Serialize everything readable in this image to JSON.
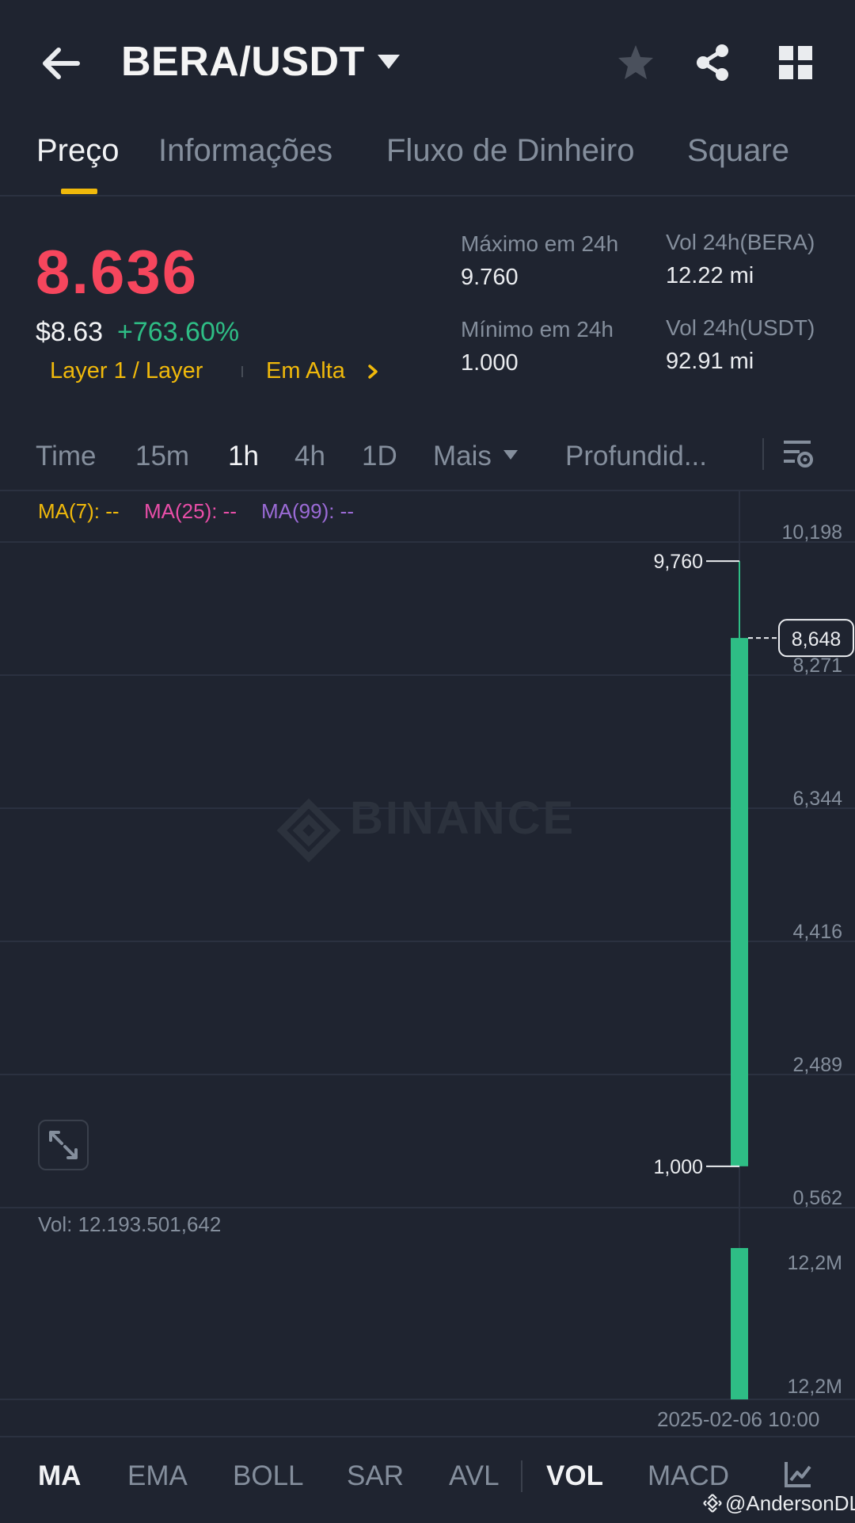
{
  "header": {
    "pair": "BERA/USDT"
  },
  "tabs": [
    {
      "label": "Preço",
      "active": true
    },
    {
      "label": "Informações",
      "active": false
    },
    {
      "label": "Fluxo de Dinheiro",
      "active": false
    },
    {
      "label": "Square",
      "active": false
    }
  ],
  "ticker": {
    "last_price": "8.636",
    "usd_price": "$8.63",
    "change_pct": "+763.60%",
    "tags": [
      "Layer 1 / Layer",
      "Em Alta"
    ],
    "high_label": "Máximo em 24h",
    "high_value": "9.760",
    "low_label": "Mínimo em 24h",
    "low_value": "1.000",
    "vol_base_label": "Vol 24h(BERA)",
    "vol_base_value": "12.22 mi",
    "vol_quote_label": "Vol 24h(USDT)",
    "vol_quote_value": "92.91 mi"
  },
  "timeframes": [
    {
      "label": "Time",
      "active": false
    },
    {
      "label": "15m",
      "active": false
    },
    {
      "label": "1h",
      "active": true
    },
    {
      "label": "4h",
      "active": false
    },
    {
      "label": "1D",
      "active": false
    },
    {
      "label": "Mais",
      "active": false
    },
    {
      "label": "Profundid...",
      "active": false
    }
  ],
  "ma": [
    {
      "label": "MA(7): --",
      "color": "#f0b90b"
    },
    {
      "label": "MA(25): --",
      "color": "#e94ea8"
    },
    {
      "label": "MA(99): --",
      "color": "#9b6bd6"
    }
  ],
  "chart_data": {
    "type": "candlestick",
    "watermark": "BINANCE",
    "y_ticks": [
      "10,198",
      "8,271",
      "6,344",
      "4,416",
      "2,489",
      "0,562"
    ],
    "y_tick_values": [
      10.198,
      8.271,
      6.344,
      4.416,
      2.489,
      0.562
    ],
    "ylim": [
      0.562,
      10.198
    ],
    "candles": [
      {
        "time": "2025-02-06 10:00",
        "open": 1.0,
        "high": 9.76,
        "low": 1.0,
        "close": 8.648,
        "volume": 12193501642
      }
    ],
    "high_marker": "9,760",
    "low_marker": "1,000",
    "current_price_label": "8,648",
    "volume_label": "Vol: 12.193.501,642",
    "volume_ticks": [
      "12,2M",
      "12,2M"
    ],
    "x_label": "2025-02-06 10:00",
    "up_color": "#2ebd85"
  },
  "indicators": [
    {
      "label": "MA",
      "active": true
    },
    {
      "label": "EMA",
      "active": false
    },
    {
      "label": "BOLL",
      "active": false
    },
    {
      "label": "SAR",
      "active": false
    },
    {
      "label": "AVL",
      "active": false
    },
    {
      "label": "VOL",
      "active": true
    },
    {
      "label": "MACD",
      "active": false
    }
  ],
  "watermark_user": "@AndersonDL"
}
